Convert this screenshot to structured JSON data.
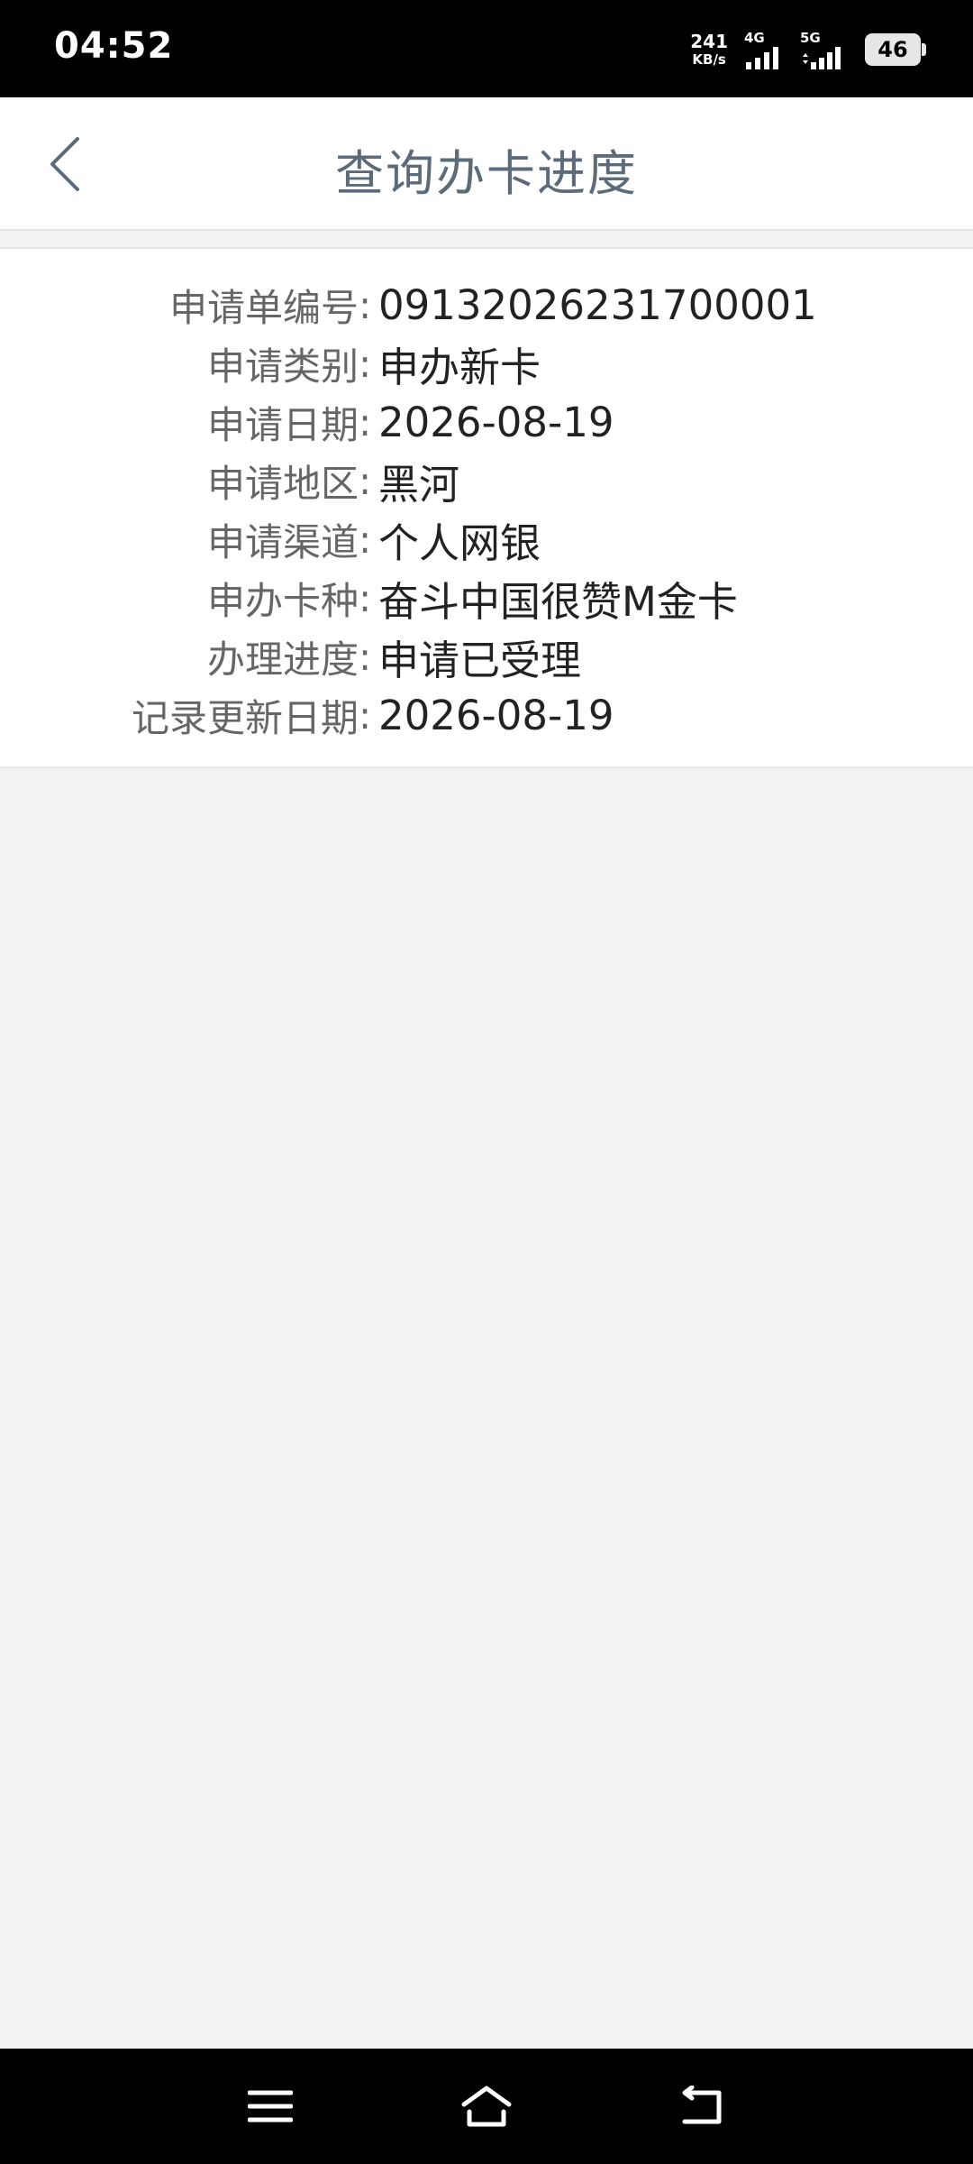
{
  "status_bar": {
    "time": "04:52",
    "net_speed_value": "241",
    "net_speed_unit": "KB/s",
    "signal_1_label": "4G",
    "signal_2_label": "5G",
    "battery_level": "46"
  },
  "header": {
    "title": "查询办卡进度",
    "back_icon": "chevron-left-icon"
  },
  "info": {
    "rows": [
      {
        "label": "申请单编号",
        "colon": ":",
        "value": "09132026231700001"
      },
      {
        "label": "申请类别",
        "colon": ":",
        "value": "申办新卡"
      },
      {
        "label": "申请日期",
        "colon": ":",
        "value": "2026-08-19"
      },
      {
        "label": "申请地区",
        "colon": ":",
        "value": "黑河"
      },
      {
        "label": "申请渠道",
        "colon": ":",
        "value": "个人网银"
      },
      {
        "label": "申办卡种",
        "colon": ":",
        "value": "奋斗中国很赞M金卡"
      },
      {
        "label": "办理进度",
        "colon": ":",
        "value": "申请已受理"
      },
      {
        "label": "记录更新日期",
        "colon": ":",
        "value": "2026-08-19"
      }
    ]
  },
  "nav": {
    "menu_icon": "menu-icon",
    "home_icon": "home-icon",
    "back_icon": "back-arrow-icon"
  },
  "colors": {
    "title_color": "#5c6b7b",
    "label_color": "#666666",
    "value_color": "#222222",
    "background": "#f2f2f2"
  }
}
